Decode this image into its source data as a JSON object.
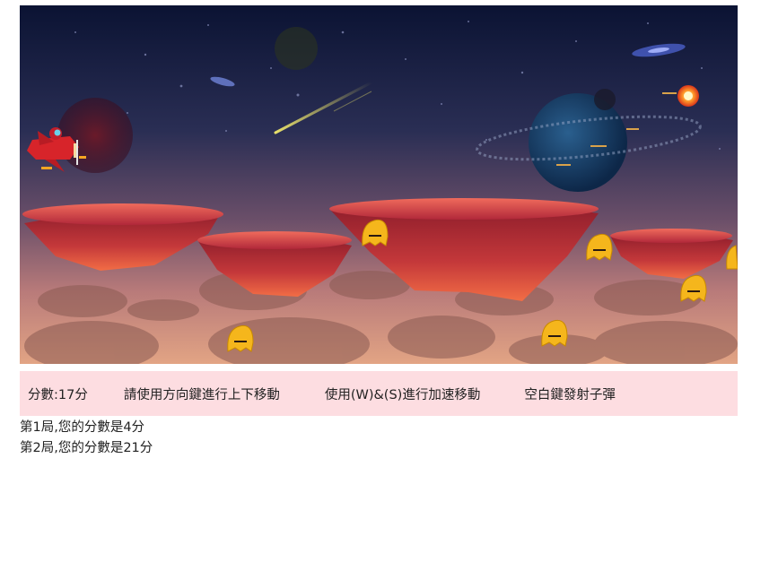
{
  "game": {
    "sprites": {
      "player": "red-rocket-plane-with-pilot",
      "enemies": "yellow-blob-monster",
      "projectile": "fireball"
    },
    "colors": {
      "sky_top": "#0b1333",
      "sky_bottom": "#d99a80",
      "rock": "#c83a38",
      "monster": "#f5b61c",
      "status_bar": "#fddde1"
    }
  },
  "status": {
    "score": "分數:17分",
    "hint_move": "請使用方向鍵進行上下移動",
    "hint_speed": "使用(W)&(S)進行加速移動",
    "hint_fire": "空白鍵發射子彈"
  },
  "history": [
    "第1局,您的分數是4分",
    "第2局,您的分數是21分"
  ]
}
